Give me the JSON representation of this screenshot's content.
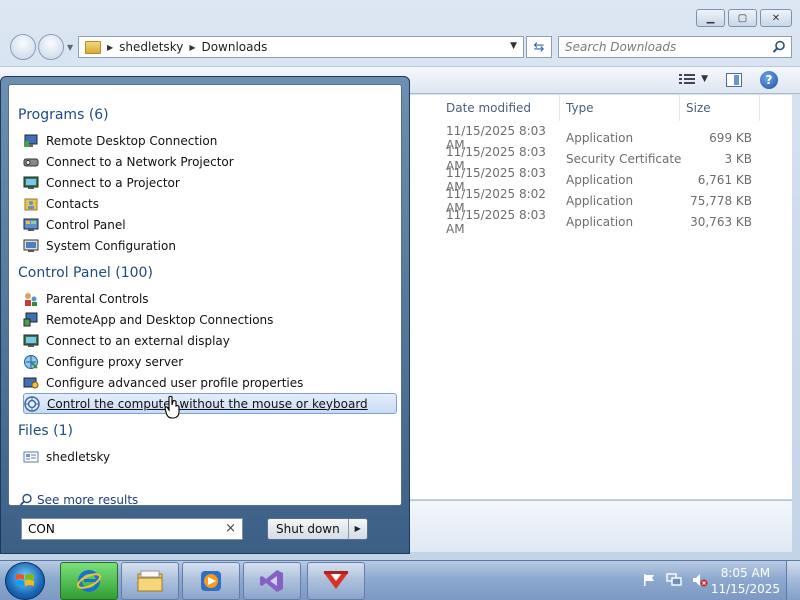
{
  "explorer": {
    "breadcrumb": [
      "shedletsky",
      "Downloads"
    ],
    "search_placeholder": "Search Downloads",
    "columns": [
      "Date modified",
      "Type",
      "Size"
    ],
    "files": [
      {
        "date": "11/15/2025 8:03 AM",
        "type": "Application",
        "size": "699 KB"
      },
      {
        "date": "11/15/2025 8:03 AM",
        "type": "Security Certificate",
        "size": "3 KB"
      },
      {
        "date": "11/15/2025 8:03 AM",
        "type": "Application",
        "size": "6,761 KB"
      },
      {
        "date": "11/15/2025 8:02 AM",
        "type": "Application",
        "size": "75,778 KB"
      },
      {
        "date": "11/15/2025 8:03 AM",
        "type": "Application",
        "size": "30,763 KB"
      }
    ]
  },
  "start_menu": {
    "programs_header": "Programs (6)",
    "programs": [
      {
        "label": "Remote Desktop Connection",
        "icon": "remote-desktop-icon"
      },
      {
        "label": "Connect to a Network Projector",
        "icon": "network-projector-icon"
      },
      {
        "label": "Connect to a Projector",
        "icon": "projector-icon"
      },
      {
        "label": "Contacts",
        "icon": "contacts-icon"
      },
      {
        "label": "Control Panel",
        "icon": "control-panel-icon"
      },
      {
        "label": "System Configuration",
        "icon": "system-configuration-icon"
      }
    ],
    "control_panel_header": "Control Panel (100)",
    "control_panel": [
      {
        "label": "Parental Controls",
        "icon": "parental-controls-icon"
      },
      {
        "label": "RemoteApp and Desktop Connections",
        "icon": "remoteapp-icon"
      },
      {
        "label": "Connect to an external display",
        "icon": "external-display-icon"
      },
      {
        "label": "Configure proxy server",
        "icon": "proxy-server-icon"
      },
      {
        "label": "Configure advanced user profile properties",
        "icon": "user-profile-icon"
      },
      {
        "label": "Control the computer without the mouse or keyboard",
        "icon": "ease-of-access-icon"
      }
    ],
    "files_header": "Files (1)",
    "files": [
      {
        "label": "shedletsky",
        "icon": "file-icon"
      }
    ],
    "see_more": "See more results",
    "search_value": "CON",
    "shutdown_label": "Shut down"
  },
  "taskbar": {
    "time": "8:05 AM",
    "date": "11/15/2025"
  },
  "colors": {
    "group_header": "#1f4a8a",
    "selection": "#c9dcf5",
    "taskbar": "#8da9cf"
  }
}
